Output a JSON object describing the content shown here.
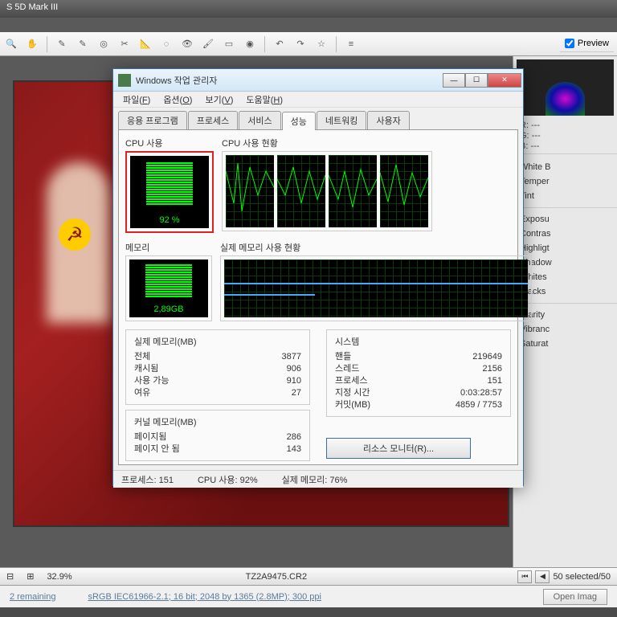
{
  "app": {
    "title": "S 5D Mark III",
    "preview_label": "Preview",
    "rgb": {
      "r_label": "R:",
      "g_label": "G:",
      "b_label": "B:",
      "r": "---",
      "g": "---",
      "b": "---"
    },
    "sliders": [
      "White B",
      "Temper",
      "Tint",
      "Exposu",
      "Contras",
      "Highligt",
      "Shadow",
      "Whites",
      "Blacks",
      "Clarity",
      "Vibranc",
      "Saturat"
    ],
    "zoom": "32.9%",
    "filename": "TZ2A9475.CR2",
    "selected": "50 selected/50",
    "remaining": "2 remaining",
    "profile": "sRGB IEC61966-2.1; 16 bit; 2048 by 1365 (2.8MP); 300 ppi",
    "open_btn": "Open Imag"
  },
  "tm": {
    "title": "Windows 작업 관리자",
    "menus": [
      {
        "label": "파일",
        "key": "F"
      },
      {
        "label": "옵션",
        "key": "O"
      },
      {
        "label": "보기",
        "key": "V"
      },
      {
        "label": "도움말",
        "key": "H"
      }
    ],
    "tabs": [
      "응용 프로그램",
      "프로세스",
      "서비스",
      "성능",
      "네트워킹",
      "사용자"
    ],
    "active_tab": 3,
    "cpu_label": "CPU 사용",
    "cpu_pct": "92 %",
    "cpu_history_label": "CPU 사용 현황",
    "mem_label": "메모리",
    "mem_val": "2,89GB",
    "mem_history_label": "실제 메모리 사용 현황",
    "phys_mem": {
      "title": "실제 메모리(MB)",
      "rows": [
        {
          "k": "전체",
          "v": "3877"
        },
        {
          "k": "캐시됨",
          "v": "906"
        },
        {
          "k": "사용 가능",
          "v": "910"
        },
        {
          "k": "여유",
          "v": "27"
        }
      ]
    },
    "kernel_mem": {
      "title": "커널 메모리(MB)",
      "rows": [
        {
          "k": "페이지됨",
          "v": "286"
        },
        {
          "k": "페이지 안 됨",
          "v": "143"
        }
      ]
    },
    "system": {
      "title": "시스템",
      "rows": [
        {
          "k": "핸들",
          "v": "219649"
        },
        {
          "k": "스레드",
          "v": "2156"
        },
        {
          "k": "프로세스",
          "v": "151"
        },
        {
          "k": "지정 시간",
          "v": "0:03:28:57"
        },
        {
          "k": "커밋(MB)",
          "v": "4859 / 7753"
        }
      ]
    },
    "resource_btn": "리소스 모니터(R)...",
    "status": {
      "processes": "프로세스: 151",
      "cpu": "CPU 사용: 92%",
      "mem": "실제 메모리: 76%"
    }
  }
}
